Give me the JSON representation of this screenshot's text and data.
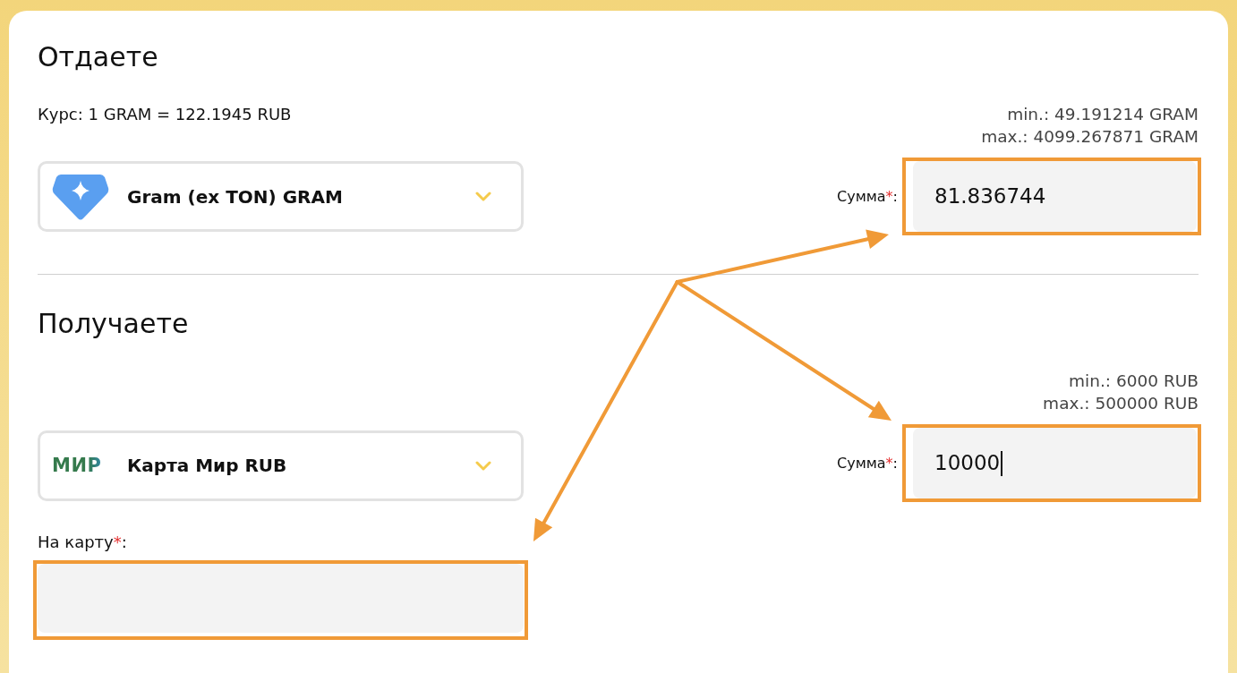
{
  "sections": [
    {
      "title": "Отдаете",
      "rate": "Курс: 1 GRAM = 122.1945 RUB",
      "limits": [
        "min.: 49.191214 GRAM",
        "max.: 4099.267871 GRAM"
      ],
      "currency_select": {
        "kind": "crypto",
        "label": "Gram (ex TON) GRAM"
      },
      "amount": {
        "label": "Сумма",
        "required_mark": "*",
        "label_suffix": ":",
        "value": "81.836744",
        "focused": false,
        "highlighted": true
      }
    },
    {
      "title": "Получаете",
      "limits": [
        "min.: 6000 RUB",
        "max.: 500000 RUB"
      ],
      "currency_select": {
        "kind": "card",
        "logo_text": "МИР",
        "label": "Карта Мир RUB"
      },
      "amount": {
        "label": "Сумма",
        "required_mark": "*",
        "label_suffix": ":",
        "value": "10000",
        "focused": true,
        "highlighted": true
      },
      "card_field": {
        "label": "На карту",
        "required_mark": "*",
        "label_suffix": ":",
        "highlighted": true
      }
    }
  ]
}
